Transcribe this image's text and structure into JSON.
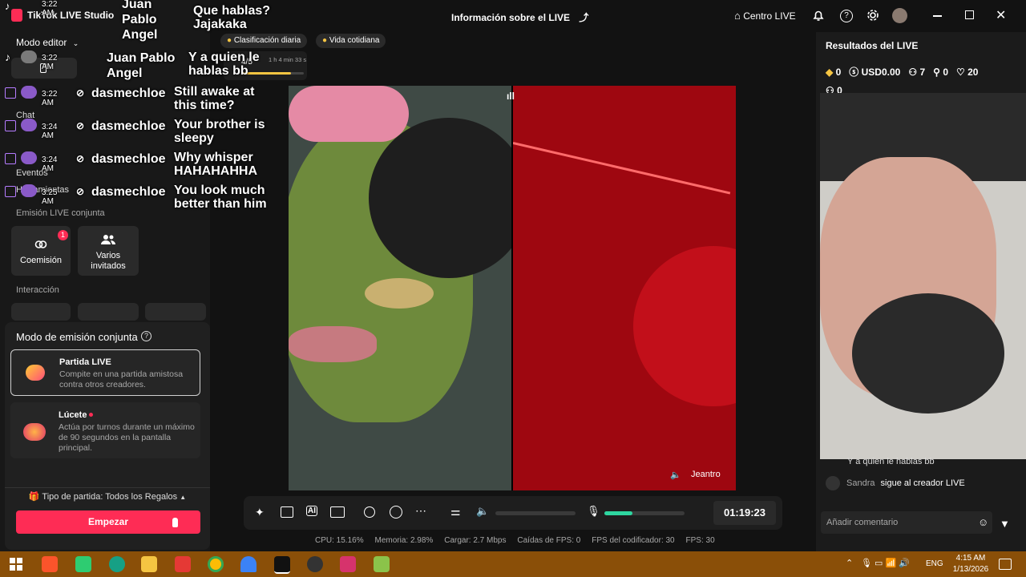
{
  "app": {
    "title": "TikTok LIVE Studio"
  },
  "topbar": {
    "live_info": "Información sobre el LIVE",
    "live_center": "Centro LIVE"
  },
  "pills": {
    "ranking": "Clasificación diaria",
    "category": "Vida cotidiana"
  },
  "session": {
    "level": "4/5",
    "duration": "1 h 4 min 33 s"
  },
  "sidebar": {
    "mode_editor": "Modo editor",
    "chat": "Chat",
    "eventos": "Eventos",
    "herramientas": "Herramientas",
    "section_cohost": "Emisión LIVE conjunta",
    "coemision": "Coemisión",
    "coemision_badge": "1",
    "multi_guest": "Varios invitados",
    "section_interaction": "Interacción"
  },
  "cohost_mode": {
    "title": "Modo de emisión conjunta",
    "options": [
      {
        "title": "Partida LIVE",
        "desc": "Compite en una partida amistosa contra otros creadores."
      },
      {
        "title": "Lúcete",
        "desc": "Actúa por turnos durante un máximo de 90 segundos en la pantalla principal."
      }
    ],
    "match_type": "Tipo de partida: Todos los Regalos",
    "start_button": "Empezar"
  },
  "overlay_chat": [
    {
      "time": "3:22 AM",
      "user": "Juan Pablo Angel",
      "message": "Que hablas? Jajakaka"
    },
    {
      "time": "3:22 AM",
      "user": "Juan Pablo Angel",
      "message": "Y a quien le hablas bb"
    },
    {
      "time": "3:22 AM",
      "user": "dasmechloe",
      "message": "Still awake at this time?"
    },
    {
      "time": "3:24 AM",
      "user": "dasmechloe",
      "message": "Your brother is sleepy"
    },
    {
      "time": "3:24 AM",
      "user": "dasmechloe",
      "message": "Why whisper HAHAHAHHA"
    },
    {
      "time": "3:25 AM",
      "user": "dasmechloe",
      "message": "You look much better than him"
    }
  ],
  "preview": {
    "guest_name": "Jeantro"
  },
  "controls": {
    "timer": "01:19:23",
    "volume_level": 0.0,
    "mic_level": 0.35
  },
  "stats": {
    "cpu": "CPU: 15.16%",
    "memory": "Memoria: 2.98%",
    "upload": "Cargar: 2.7 Mbps",
    "fps_drop": "Caídas de FPS: 0",
    "encoder_fps": "FPS del codificador: 30",
    "fps": "FPS: 30"
  },
  "results": {
    "title": "Resultados del LIVE",
    "diamonds": "0",
    "usd": "USD0.00",
    "viewers": "7",
    "new_followers": "0",
    "likes": "20",
    "gifters": "0"
  },
  "comments": [
    {
      "user": "",
      "text": "Y a quien le hablas bb"
    },
    {
      "user": "Sandra",
      "text": "sigue al creador LIVE"
    }
  ],
  "comment_input": {
    "placeholder": "Añadir comentario"
  },
  "taskbar": {
    "lang": "ENG",
    "time": "4:15 AM",
    "date": "1/13/2026"
  },
  "colors": {
    "accent": "#fe2c55",
    "mic_level": "#2ed6a0",
    "taskbar": "#8a4f08"
  }
}
